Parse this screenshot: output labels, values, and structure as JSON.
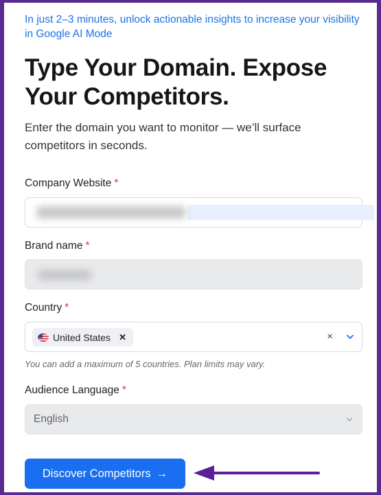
{
  "intro": "In just 2–3 minutes, unlock actionable insights to increase your visibility in Google AI Mode",
  "title": "Type Your Domain. Expose Your Competitors.",
  "subtitle": "Enter the domain you want to monitor — we’ll surface competitors in seconds.",
  "fields": {
    "company_website": {
      "label": "Company Website",
      "required": "*",
      "value": ""
    },
    "brand_name": {
      "label": "Brand name",
      "required": "*",
      "value": ""
    },
    "country": {
      "label": "Country",
      "required": "*",
      "selected": [
        "United States"
      ],
      "remove_glyph": "✕",
      "clear_glyph": "×",
      "hint": "You can add a maximum of 5 countries. Plan limits may vary."
    },
    "audience_language": {
      "label": "Audience Language",
      "required": "*",
      "value": "English"
    }
  },
  "submit": {
    "label": "Discover Competitors",
    "arrow": "→"
  },
  "colors": {
    "frame": "#5b2a8e",
    "accent": "#1a6ef0",
    "link": "#1a73e8",
    "required": "#e0304a",
    "annotation_arrow": "#5b1f9a"
  },
  "icons": [
    "us-flag-icon",
    "remove-tag-icon",
    "clear-icon",
    "chevron-down-icon",
    "arrow-right-icon",
    "annotation-arrow-icon"
  ]
}
